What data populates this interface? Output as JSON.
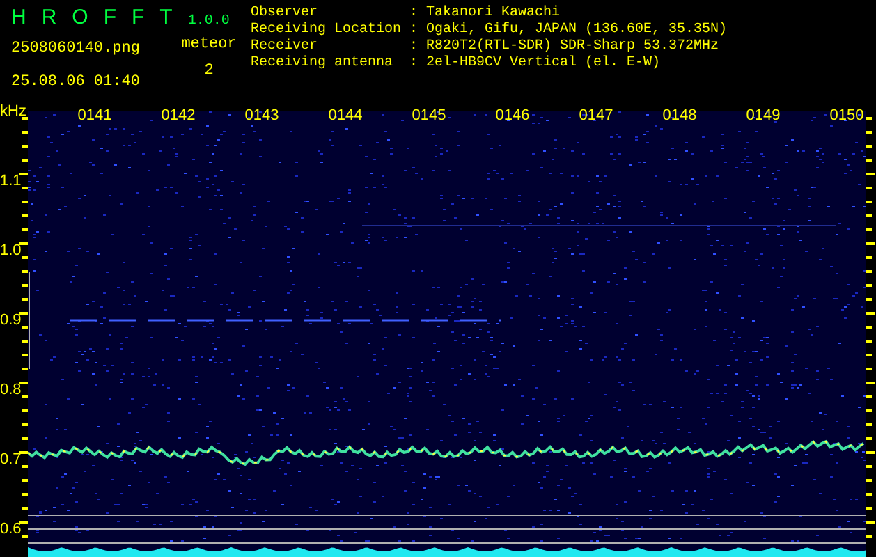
{
  "app": {
    "title": "HROFFT",
    "version": "1.0.0"
  },
  "file": {
    "name": "2508060140.png",
    "datetime": "25.08.06 01:40"
  },
  "meteor": {
    "label": "meteor",
    "count": "2"
  },
  "info": [
    {
      "label": "Observer",
      "sep": ":",
      "value": "Takanori Kawachi"
    },
    {
      "label": "Receiving Location",
      "sep": ":",
      "value": "Ogaki, Gifu, JAPAN (136.60E, 35.35N)"
    },
    {
      "label": "Receiver",
      "sep": ":",
      "value": "R820T2(RTL-SDR) SDR-Sharp 53.372MHz"
    },
    {
      "label": "Receiving antenna",
      "sep": ":",
      "value": "2el-HB9CV Vertical (el. E-W)"
    }
  ],
  "spectrogram": {
    "unit": "kHz",
    "freq_labels": [
      "1.1",
      "1.0",
      "0.9",
      "0.8",
      "0.7",
      "0.6"
    ],
    "time_labels": [
      "0141",
      "0142",
      "0143",
      "0144",
      "0145",
      "0146",
      "0147",
      "0148",
      "0149",
      "0150"
    ]
  }
}
